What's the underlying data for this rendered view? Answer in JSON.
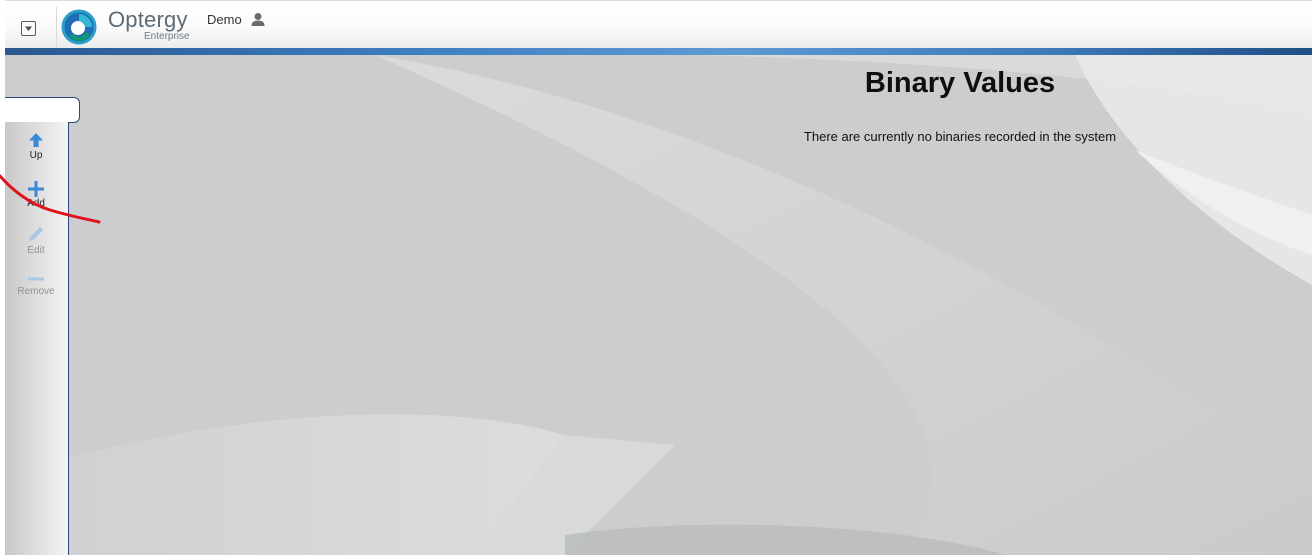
{
  "header": {
    "brand": "Optergy",
    "brand_subtitle": "Enterprise",
    "user_name": "Demo",
    "menu_icon": "dropdown-toggle-icon",
    "user_icon": "user-icon"
  },
  "sidebar": {
    "buttons": [
      {
        "label": "Up",
        "icon": "arrow-up-icon",
        "enabled": true
      },
      {
        "label": "Add",
        "icon": "plus-icon",
        "enabled": true
      },
      {
        "label": "Edit",
        "icon": "pencil-icon",
        "enabled": false
      },
      {
        "label": "Remove",
        "icon": "minus-icon",
        "enabled": false
      }
    ]
  },
  "main": {
    "title": "Binary Values",
    "empty_message": "There are currently no binaries recorded in the system"
  },
  "colors": {
    "accent_bar": "#3d7cbf",
    "icon_blue": "#3a8ad6",
    "icon_disabled": "#a9c6e6",
    "annotation_red": "#e0141c"
  }
}
